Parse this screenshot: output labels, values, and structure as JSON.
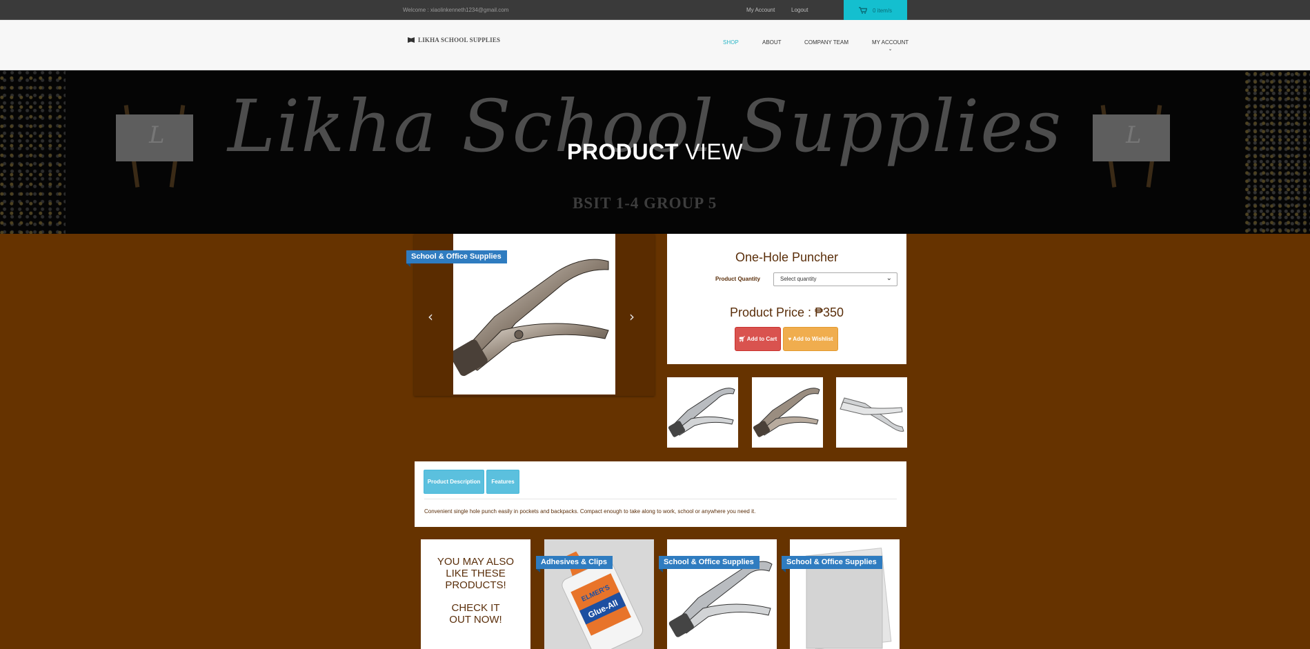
{
  "topbar": {
    "welcome": "Welcome : xiaolinkenneth1234@gmail.com",
    "my_account": "My Account",
    "logout": "Logout",
    "cart": "0 item/s",
    "cart_color": "#14bfcf"
  },
  "navbar": {
    "brand": "LIKHA SCHOOL SUPPLIES",
    "items": [
      "SHOP",
      "ABOUT",
      "COMPANY TEAM",
      "MY ACCOUNT"
    ],
    "active_color": "#2bb6c7"
  },
  "hero": {
    "script": "Likha School Supplies",
    "easel_letter": "L",
    "subtitle": "BSIT 1-4 GROUP 5",
    "title_bold": "PRODUCT",
    "title_rest": " VIEW"
  },
  "product": {
    "category_tag": "School & Office Supplies",
    "name": "One-Hole Puncher",
    "quantity_label": "Product Quantity",
    "quantity_placeholder": "Select quantity",
    "price_text": "Product Price : ₱350",
    "add_to_cart": "Add to Cart",
    "add_to_wishlist": "Add to Wishlist"
  },
  "tabs": {
    "items": [
      "Product Description",
      "Features"
    ],
    "description": "Convenient single hole punch easily in pockets and backpacks. Compact enough to take along to work, school or anywhere you need it."
  },
  "related": {
    "promo_line1": "YOU MAY ALSO LIKE THESE PRODUCTS!",
    "promo_line2": "CHECK IT OUT NOW!",
    "cards": [
      {
        "tag": "Adhesives & Clips",
        "label": "ELMER'S",
        "product": "Glue-All"
      },
      {
        "tag": "School & Office Supplies"
      },
      {
        "tag": "School & Office Supplies"
      }
    ]
  },
  "colors": {
    "page_bg": "#663300",
    "tag_bg": "#2f7cc0",
    "add_to_cart_bg": "#d9534f",
    "wishlist_bg": "#f0ad4e",
    "tab_bg": "#5bc0de"
  }
}
